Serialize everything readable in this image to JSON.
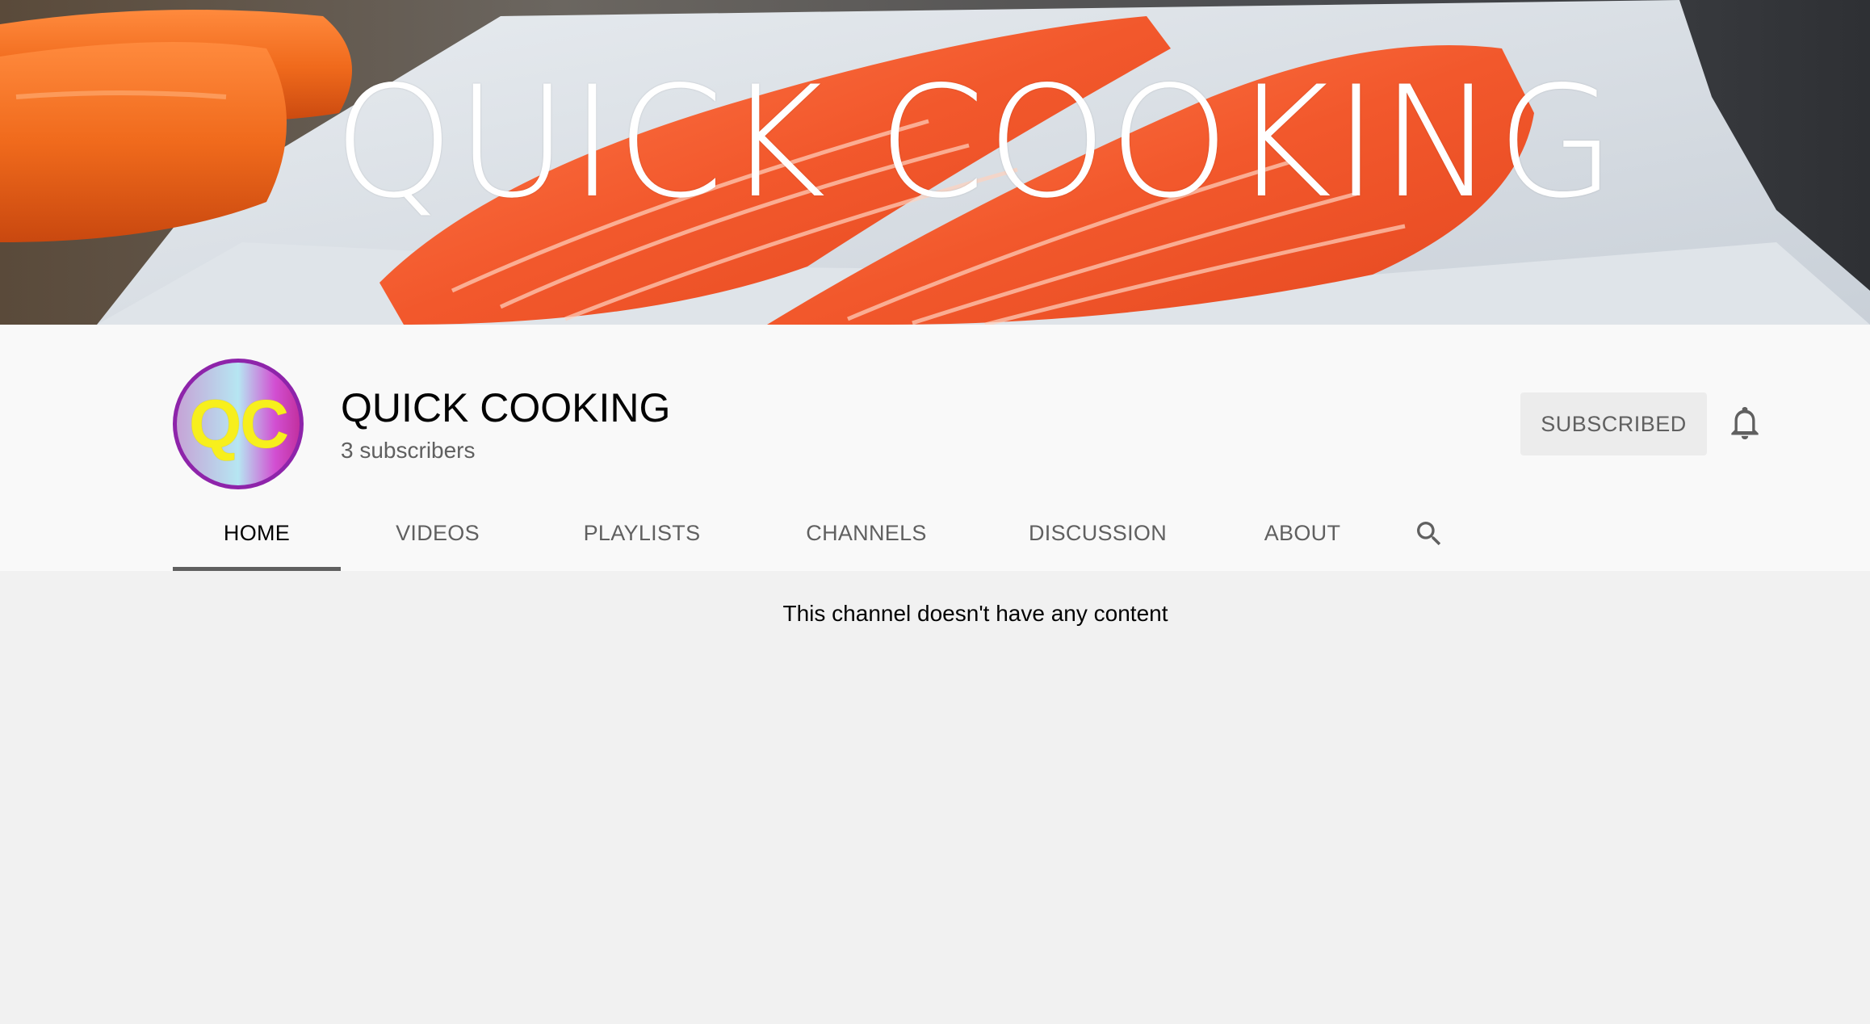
{
  "banner": {
    "title": "QUICK COOKING"
  },
  "channel": {
    "avatar_text": "QC",
    "name": "QUICK COOKING",
    "subscribers": "3 subscribers",
    "subscribe_label": "SUBSCRIBED"
  },
  "tabs": [
    {
      "label": "HOME",
      "active": true
    },
    {
      "label": "VIDEOS",
      "active": false
    },
    {
      "label": "PLAYLISTS",
      "active": false
    },
    {
      "label": "CHANNELS",
      "active": false
    },
    {
      "label": "DISCUSSION",
      "active": false
    },
    {
      "label": "ABOUT",
      "active": false
    }
  ],
  "search_icon": "search-icon",
  "bell_icon": "bell-icon",
  "main": {
    "empty_message": "This channel doesn't have any content"
  },
  "colors": {
    "active_tab_underline": "#606060",
    "subscribed_button_bg": "#ececec",
    "avatar_border": "#8e24aa",
    "avatar_text": "#f7ef1d"
  }
}
